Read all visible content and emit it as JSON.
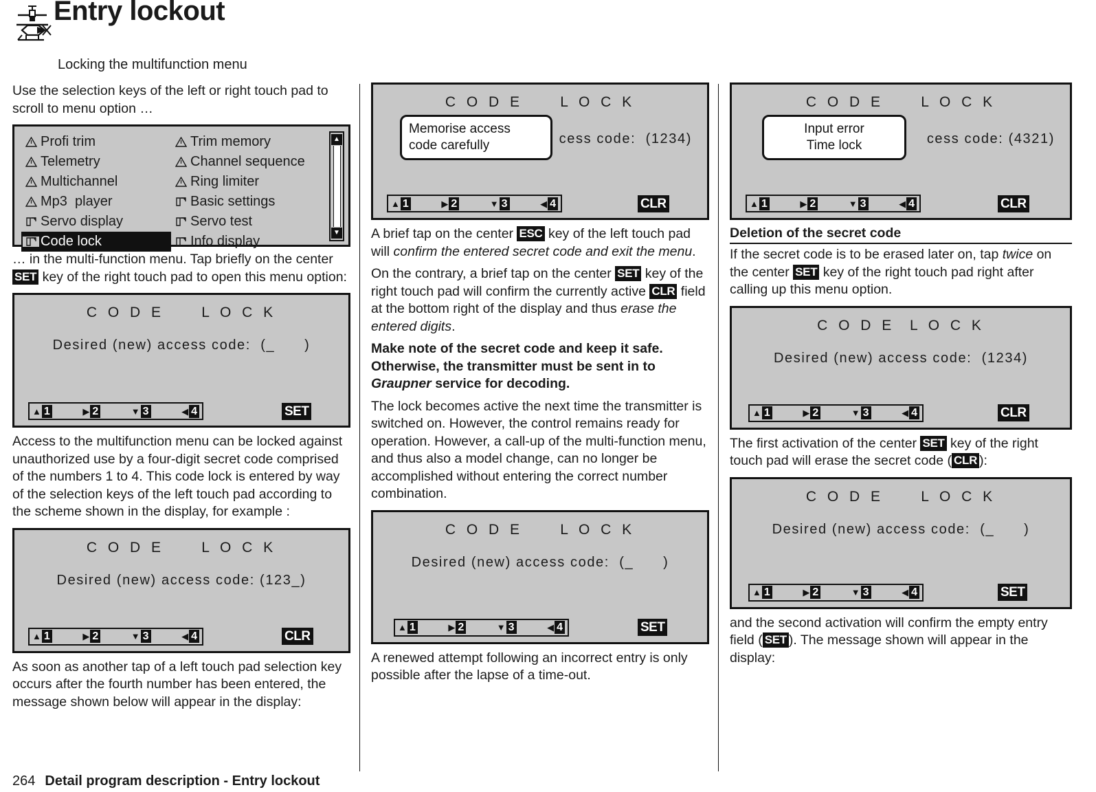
{
  "header": {
    "title": "Entry lockout",
    "subtitle": "Locking the multifunction menu",
    "icon": "helicopter-icon"
  },
  "footer": {
    "page_number": "264",
    "text": "Detail program description - Entry lockout"
  },
  "menu_display": {
    "left_items": [
      {
        "icon": "warning-triangle-icon",
        "label": "Profi trim",
        "selected": false
      },
      {
        "icon": "warning-triangle-icon",
        "label": "Telemetry",
        "selected": false
      },
      {
        "icon": "warning-triangle-icon",
        "label": "Multichannel",
        "selected": false
      },
      {
        "icon": "warning-triangle-icon",
        "label": "Mp3  player",
        "selected": false
      },
      {
        "icon": "open-folder-icon",
        "label": "Servo display",
        "selected": false
      },
      {
        "icon": "open-folder-icon",
        "label": "Code lock",
        "selected": true
      }
    ],
    "right_items": [
      {
        "icon": "warning-triangle-icon",
        "label": "Trim memory",
        "selected": false
      },
      {
        "icon": "warning-triangle-icon",
        "label": "Channel sequence",
        "selected": false
      },
      {
        "icon": "warning-triangle-icon",
        "label": "Ring limiter",
        "selected": false
      },
      {
        "icon": "open-folder-icon",
        "label": "Basic settings",
        "selected": false
      },
      {
        "icon": "open-folder-icon",
        "label": "Servo test",
        "selected": false
      },
      {
        "icon": "open-folder-icon",
        "label": "Info display",
        "selected": false
      }
    ],
    "scroll_up": "▲",
    "scroll_down": "▼"
  },
  "nav_keys": [
    {
      "arrow": "▲",
      "number": "1"
    },
    {
      "arrow": "▶",
      "number": "2"
    },
    {
      "arrow": "▼",
      "number": "3"
    },
    {
      "arrow": "◀",
      "number": "4"
    }
  ],
  "panels": {
    "p1": {
      "title": "C O D E     L O C K",
      "line": "Desired (new) access code:  (_      )",
      "action": "SET"
    },
    "p2": {
      "title": "C O D E     L O C K",
      "line": "Desired (new) access code: (123_)",
      "action": "CLR"
    },
    "p3": {
      "title": "C O D E     L O C K",
      "line": "cess code:  (1234)",
      "action": "CLR",
      "callout": "Memorise access\ncode carefully"
    },
    "p4": {
      "title": "C O D E     L O C K",
      "line": "Desired (new) access code:  (_      )",
      "action": "SET"
    },
    "p5": {
      "title": "C O D E     L O C K",
      "line": "cess code: (4321)",
      "action": "CLR",
      "callout": "Input error\nTime lock"
    },
    "p6": {
      "title": "C O D E  L O C K",
      "line": "Desired (new) access code:  (1234)",
      "action": "CLR"
    },
    "p7": {
      "title": "C O D E     L O C K",
      "line": "Desired (new) access code:  (_      )",
      "action": "SET"
    }
  },
  "col1": {
    "para_intro": "Use the selection keys of the left or right touch pad to scroll to menu option …",
    "para_after_menu_a": "… in the multi-function menu. Tap briefly on the center ",
    "key_set": "SET",
    "para_after_menu_b": " key of the right touch pad to open this menu option:",
    "para_access": "Access to the multifunction menu can be locked against unauthorized use by a four-digit secret code comprised of the numbers 1 to 4. This code lock is entered by way of the selection keys of the left touch pad according to the scheme shown in the display, for example :",
    "para_asoon": "As soon as another tap of a left touch pad selection key occurs after the fourth number has been entered, the message shown below will appear in the display:"
  },
  "col2": {
    "p1a": "A brief tap on the center ",
    "p1_key": "ESC",
    "p1b": " key of the left touch pad will ",
    "p1_it": "confirm the entered secret code and exit the menu",
    "p1c": ".",
    "p2a": "On the contrary, a brief tap on the center ",
    "p2_key1": "SET",
    "p2b": " key of the right touch pad will confirm the currently active ",
    "p2_key2": "CLR",
    "p2c": " field at the bottom right of the display and thus ",
    "p2_it": "erase the entered digits",
    "p2d": ".",
    "p3_bold_a": "Make note of the secret code and keep it safe. Otherwise, the transmitter must be sent in to ",
    "p3_bolditalic": "Graupner",
    "p3_bold_b": " service for decoding.",
    "p4": "The lock becomes active the next time the transmitter is switched on. However, the control remains ready for operation. However, a call-up of the multi-function menu, and thus also a model change, can no longer be accomplished without entering the correct number combination.",
    "p5": "A renewed attempt following an incorrect entry is only possible after the lapse of a time-out."
  },
  "col3": {
    "heading": "Deletion of the secret code",
    "p1a": "If the secret code is to be erased later on, tap ",
    "p1_it": "twice",
    "p1b": " on the center ",
    "p1_key": "SET",
    "p1c": " key of the right touch pad right after calling up this menu option.",
    "p2a": "The first activation of the center ",
    "p2_key1": "SET",
    "p2b": " key of the right touch pad will erase the secret code (",
    "p2_key2": "CLR",
    "p2c": "):",
    "p3a": "and the second activation will confirm the empty entry field (",
    "p3_key": "SET",
    "p3b": "). The message shown will appear in the display:"
  },
  "colors": {
    "lcd_background": "#c7c7c7",
    "ink": "#111111",
    "page_background": "#ffffff"
  }
}
